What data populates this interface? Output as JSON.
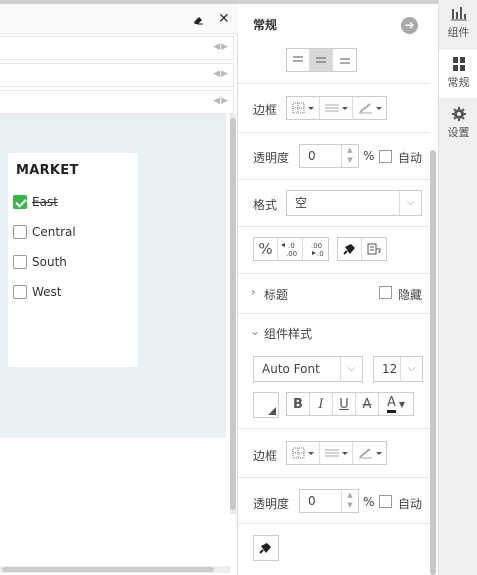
{
  "filter_widget": {
    "title": "MARKET",
    "items": [
      {
        "label": "East",
        "checked": true
      },
      {
        "label": "Central",
        "checked": false
      },
      {
        "label": "South",
        "checked": false
      },
      {
        "label": "West",
        "checked": false
      }
    ]
  },
  "panel": {
    "title": "常规",
    "border_label": "边框",
    "opacity_label": "透明度",
    "opacity_value": "0",
    "percent": "%",
    "auto_label": "自动",
    "format_label": "格式",
    "format_value": "空",
    "num_btn_percent": "%",
    "title_section": "标题",
    "hide_label": "隐藏",
    "widget_style_section": "组件样式",
    "font_value": "Auto Font",
    "font_size_value": "12",
    "bold": "B",
    "italic": "I",
    "underline": "U",
    "strike": "A",
    "font_color": "A",
    "border_label2": "边框",
    "opacity_label2": "透明度",
    "opacity_value2": "0",
    "percent2": "%",
    "auto_label2": "自动"
  },
  "tabs": [
    {
      "label": "组件",
      "active": false
    },
    {
      "label": "常规",
      "active": true
    },
    {
      "label": "设置",
      "active": false
    }
  ],
  "colors": {
    "accent_check": "#3bb54a",
    "canvas_bg": "#e8f0f4"
  }
}
